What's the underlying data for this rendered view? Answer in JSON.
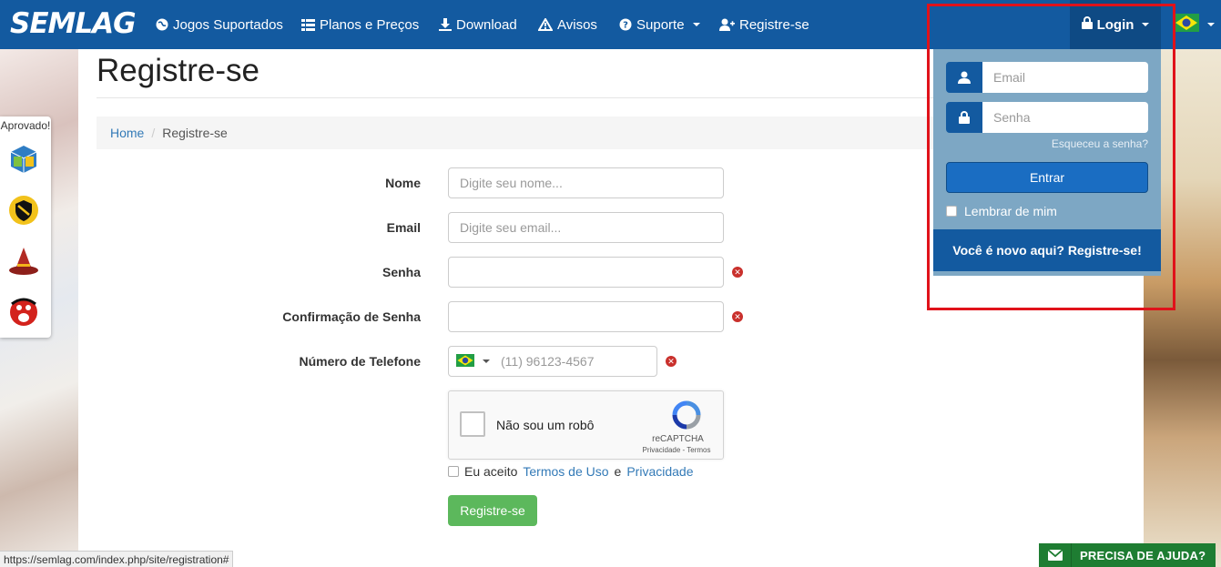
{
  "nav": {
    "brand": "SEMLAG",
    "items": [
      {
        "label": "Jogos Suportados",
        "icon": "globe-icon"
      },
      {
        "label": "Planos e Preços",
        "icon": "list-icon"
      },
      {
        "label": "Download",
        "icon": "download-icon"
      },
      {
        "label": "Avisos",
        "icon": "warning-icon"
      },
      {
        "label": "Suporte",
        "icon": "question-icon"
      },
      {
        "label": "Registre-se",
        "icon": "user-plus-icon"
      }
    ],
    "login_label": "Login",
    "language_flag": "brazil-flag-icon"
  },
  "page": {
    "title": "Registre-se",
    "breadcrumb": {
      "home": "Home",
      "current": "Registre-se"
    }
  },
  "form": {
    "name_label": "Nome",
    "name_placeholder": "Digite seu nome...",
    "email_label": "Email",
    "email_placeholder": "Digite seu email...",
    "password_label": "Senha",
    "confirm_label": "Confirmação de Senha",
    "phone_label": "Número de Telefone",
    "phone_placeholder": "(11) 96123-4567",
    "captcha_text": "Não sou um robô",
    "captcha_brand": "reCAPTCHA",
    "captcha_terms": "Privacidade - Termos",
    "agree_prefix": "Eu aceito",
    "terms_link": "Termos de Uso",
    "agree_and": "e",
    "privacy_link": "Privacidade",
    "submit_label": "Registre-se"
  },
  "badges": {
    "header": "Aprovado!"
  },
  "login_panel": {
    "email_placeholder": "Email",
    "password_placeholder": "Senha",
    "forgot_link": "Esqueceu a senha?",
    "enter_button": "Entrar",
    "remember_label": "Lembrar de mim",
    "new_user_prefix": "Você é novo aqui?",
    "new_user_link": "Registre-se!"
  },
  "statusbar": {
    "url": "https://semlag.com/index.php/site/registration#"
  },
  "help": {
    "label": "PRECISA DE AJUDA?"
  },
  "colors": {
    "navbar": "#135aa0",
    "accent": "#337ab7",
    "success": "#5cb85c",
    "error": "#c9302c",
    "highlight": "#e0121a"
  }
}
